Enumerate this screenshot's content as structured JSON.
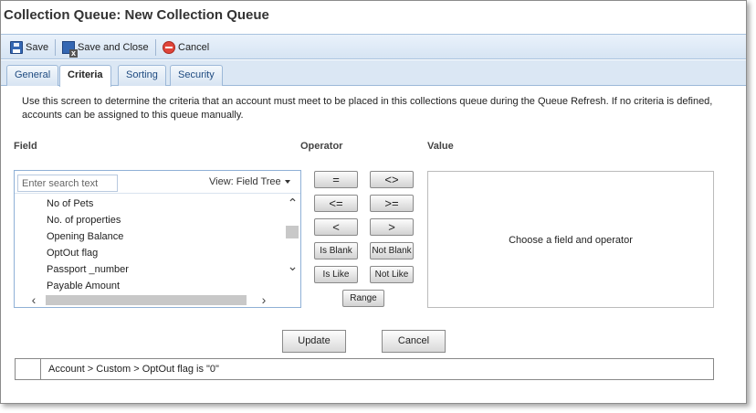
{
  "window": {
    "title": "Collection Queue: New Collection Queue"
  },
  "toolbar": {
    "save_label": "Save",
    "save_close_label": "Save and Close",
    "cancel_label": "Cancel"
  },
  "tabs": [
    "General",
    "Criteria",
    "Sorting",
    "Security"
  ],
  "active_tab": "Criteria",
  "description": "Use this screen to determine the criteria that an account must meet to be placed in this collections queue during the Queue Refresh. If no criteria is defined, accounts can be assigned to this queue manually.",
  "field_panel": {
    "header": "Field",
    "search_placeholder": "Enter search text",
    "view_label": "View: Field Tree",
    "items": [
      "No of Pets",
      "No. of properties",
      "Opening Balance",
      "OptOut flag",
      "Passport _number",
      "Payable Amount"
    ]
  },
  "operator_panel": {
    "header": "Operator",
    "buttons": [
      "=",
      "<>",
      "<=",
      ">=",
      "<",
      ">",
      "Is Blank",
      "Not Blank",
      "Is Like",
      "Not Like",
      "Range"
    ]
  },
  "value_panel": {
    "header": "Value",
    "placeholder_message": "Choose a field and operator"
  },
  "actions": {
    "update_label": "Update",
    "cancel_label": "Cancel"
  },
  "criteria": [
    {
      "text": "Account > Custom > OptOut flag is \"0\""
    }
  ],
  "colors": {
    "toolbar_bg": "#d6e4f3",
    "tab_border": "#9cb8d8",
    "accent_text": "#1e4a80"
  }
}
